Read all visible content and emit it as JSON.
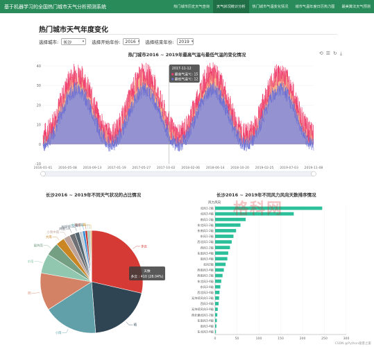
{
  "app": {
    "title": "基于机器学习的全国热门城市天气分析预测系统",
    "nav": [
      {
        "label": "热门城市历史天气查询",
        "active": false
      },
      {
        "label": "天气状况统计分析",
        "active": true
      },
      {
        "label": "热门城市气温变化情况",
        "active": false
      },
      {
        "label": "城市气温年度日历热力图",
        "active": false
      },
      {
        "label": "最美算法天气预测",
        "active": false
      }
    ]
  },
  "page": {
    "title": "热门城市天气年度变化"
  },
  "filters": {
    "city_label": "选择城市:",
    "city_value": "长沙",
    "start_label": "选择开始年份:",
    "start_value": "2016",
    "end_label": "选择结束年份:",
    "end_value": "2019"
  },
  "toolbox": [
    "restore-icon",
    "data-view-icon",
    "refresh-icon",
    "save-icon"
  ],
  "tooltip": {
    "date": "2017-11-12",
    "high": "最高气温℃: 15",
    "low": "最低气温℃: 12"
  },
  "pie_tooltip": {
    "title": "天数",
    "value": "多云 : 410 (28.04%)"
  },
  "watermark": "格科网",
  "credit": "CSDN @Python极客之家",
  "chart_data": [
    {
      "type": "area",
      "title": "热门城市2016 ~ 2019年最高气温与最低气温的变化情况",
      "x_ticks": [
        "2016-01-01",
        "2016-05-08",
        "2016-09-13",
        "2017-01-19",
        "2017-05-27",
        "2017-10-02",
        "2018-02-06",
        "2018-06-14",
        "2018-10-20",
        "2019-02-25",
        "2019-07-03",
        "2019-11-08"
      ],
      "ylim": [
        -10,
        40
      ],
      "y_ticks": [
        -10,
        0,
        10,
        20,
        30,
        40
      ],
      "colors": {
        "high": "#ef3a6b",
        "low": "#6a6fd6",
        "high_fill": "#f2a17a",
        "low_fill": "#8a8fd8"
      },
      "series": [
        {
          "name": "最高气温",
          "seasonal_min": 5,
          "seasonal_max": 36,
          "noise": 6
        },
        {
          "name": "最低气温",
          "seasonal_min": 0,
          "seasonal_max": 28,
          "noise": 4
        }
      ],
      "years": [
        2016,
        2017,
        2018,
        2019
      ]
    },
    {
      "type": "pie",
      "title": "长沙2016 ~ 2019年不同天气状况的占比情况",
      "slices": [
        {
          "label": "多云",
          "value": 410,
          "color": "#d63a34"
        },
        {
          "label": "晴",
          "value": 289,
          "color": "#2f4554"
        },
        {
          "label": "小雨",
          "value": 246,
          "color": "#61a0a8"
        },
        {
          "label": "阴",
          "value": 170,
          "color": "#d48265"
        },
        {
          "label": "中雨",
          "value": 88,
          "color": "#91c7ae"
        },
        {
          "label": "雷阵雨",
          "value": 60,
          "color": "#749f83"
        },
        {
          "label": "大雨",
          "value": 40,
          "color": "#ca8622"
        },
        {
          "label": "小到中雨",
          "value": 30,
          "color": "#bda29a"
        },
        {
          "label": "阵雨",
          "value": 25,
          "color": "#6e7074"
        },
        {
          "label": "雨夹雪",
          "value": 20,
          "color": "#546570"
        },
        {
          "label": "大到暴雨",
          "value": 15,
          "color": "#c4ccd3"
        },
        {
          "label": "小雪",
          "value": 12,
          "color": "#3a8fd6"
        },
        {
          "label": "暴雨",
          "value": 10,
          "color": "#c23531"
        },
        {
          "label": "中到大雨",
          "value": 8,
          "color": "#8fc3ae"
        },
        {
          "label": "中雪",
          "value": 6,
          "color": "#a3a3a3"
        },
        {
          "label": "雾",
          "value": 5,
          "color": "#e0b94f"
        }
      ]
    },
    {
      "type": "bar",
      "title": "长沙2016 ~ 2019年不同风力风向天数排序情况",
      "ylabel": "风力风向",
      "xlim": [
        0,
        300
      ],
      "x_ticks": [
        0,
        50,
        100,
        150,
        200,
        250,
        300
      ],
      "color": "#2bbf9a",
      "categories": [
        "北风1-2级",
        "北风3-4级",
        "南风1-2级",
        "东北风1-2级",
        "东南风1-2级",
        "东风1-2级",
        "西北风1-2级",
        "西风1-2级",
        "东南风3-4级",
        "南风3-4级",
        "北风2级",
        "西南风3-4级",
        "西南风1-2级",
        "东北风3-4级",
        "东风3-4级",
        "西北风3-4级",
        "无持续风向1-2级",
        "西风3-4级",
        "无持续风向3-4级",
        "西北偏北风1-2级",
        "东南风3-4级",
        "南风3-4级",
        "东北风3-4级"
      ],
      "values": [
        245,
        180,
        70,
        58,
        48,
        42,
        38,
        34,
        30,
        28,
        24,
        20,
        17,
        14,
        12,
        10,
        9,
        8,
        6,
        5,
        4,
        3,
        2
      ]
    }
  ]
}
